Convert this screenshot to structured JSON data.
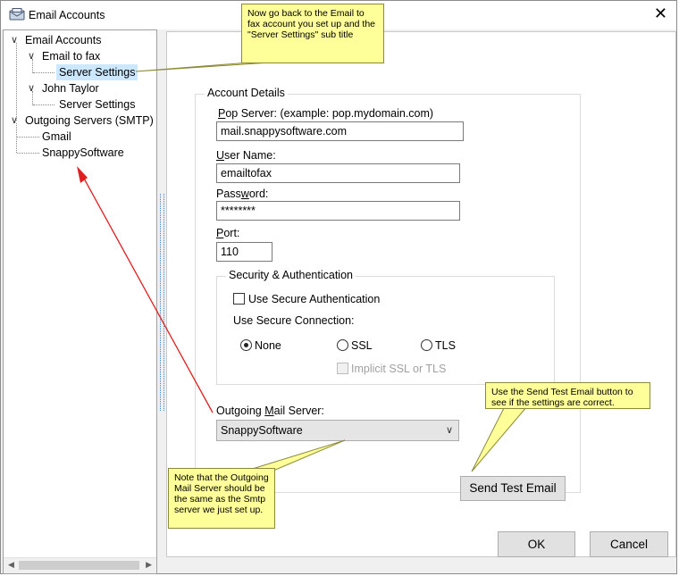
{
  "window": {
    "title": "Email Accounts",
    "close_glyph": "✕"
  },
  "tree": {
    "items": [
      {
        "label": "Email Accounts",
        "expanded": true
      },
      {
        "label": "Email to fax",
        "expanded": true
      },
      {
        "label": "Server Settings",
        "selected": true
      },
      {
        "label": "John Taylor",
        "expanded": true
      },
      {
        "label": "Server Settings"
      },
      {
        "label": "Outgoing Servers (SMTP)",
        "expanded": true
      },
      {
        "label": "Gmail"
      },
      {
        "label": "SnappySoftware"
      }
    ]
  },
  "account_details": {
    "legend": "Account Details",
    "pop_server": {
      "label_key": "P",
      "label_rest": "op Server: (example: pop.mydomain.com)",
      "value": "mail.snappysoftware.com"
    },
    "user_name": {
      "label_key": "U",
      "label_rest": "ser Name:",
      "value": "emailtofax"
    },
    "password": {
      "label_pre": "Pass",
      "label_key": "w",
      "label_rest": "ord:",
      "value": "********"
    },
    "port": {
      "label_key": "P",
      "label_rest": "ort:",
      "value": "110"
    },
    "security": {
      "legend": "Security & Authentication",
      "secure_auth_label": "Use Secure Authentication",
      "secure_auth_checked": false,
      "secure_connection_label": "Use Secure Connection:",
      "options": [
        {
          "label": "None",
          "checked": true
        },
        {
          "label": "SSL",
          "checked": false
        },
        {
          "label": "TLS",
          "checked": false
        }
      ],
      "implicit_label": "Implicit SSL or TLS",
      "implicit_enabled": false
    },
    "outgoing": {
      "label_pre": "Outgoing ",
      "label_key": "M",
      "label_rest": "ail Server:",
      "selected": "SnappySoftware"
    }
  },
  "buttons": {
    "send_test": "Send Test Email",
    "ok": "OK",
    "cancel": "Cancel"
  },
  "callouts": {
    "top": "Now go back to the Email to fax account you set up and the \"Server Settings\" sub title",
    "right": "Use the Send Test Email button to see if the settings are correct.",
    "left": "Note that the Outgoing Mail Server should be the same as the Smtp server we just set up."
  },
  "colors": {
    "callout_bg": "#ffff99",
    "selection": "#cce8ff",
    "arrow_red": "#e02020"
  }
}
